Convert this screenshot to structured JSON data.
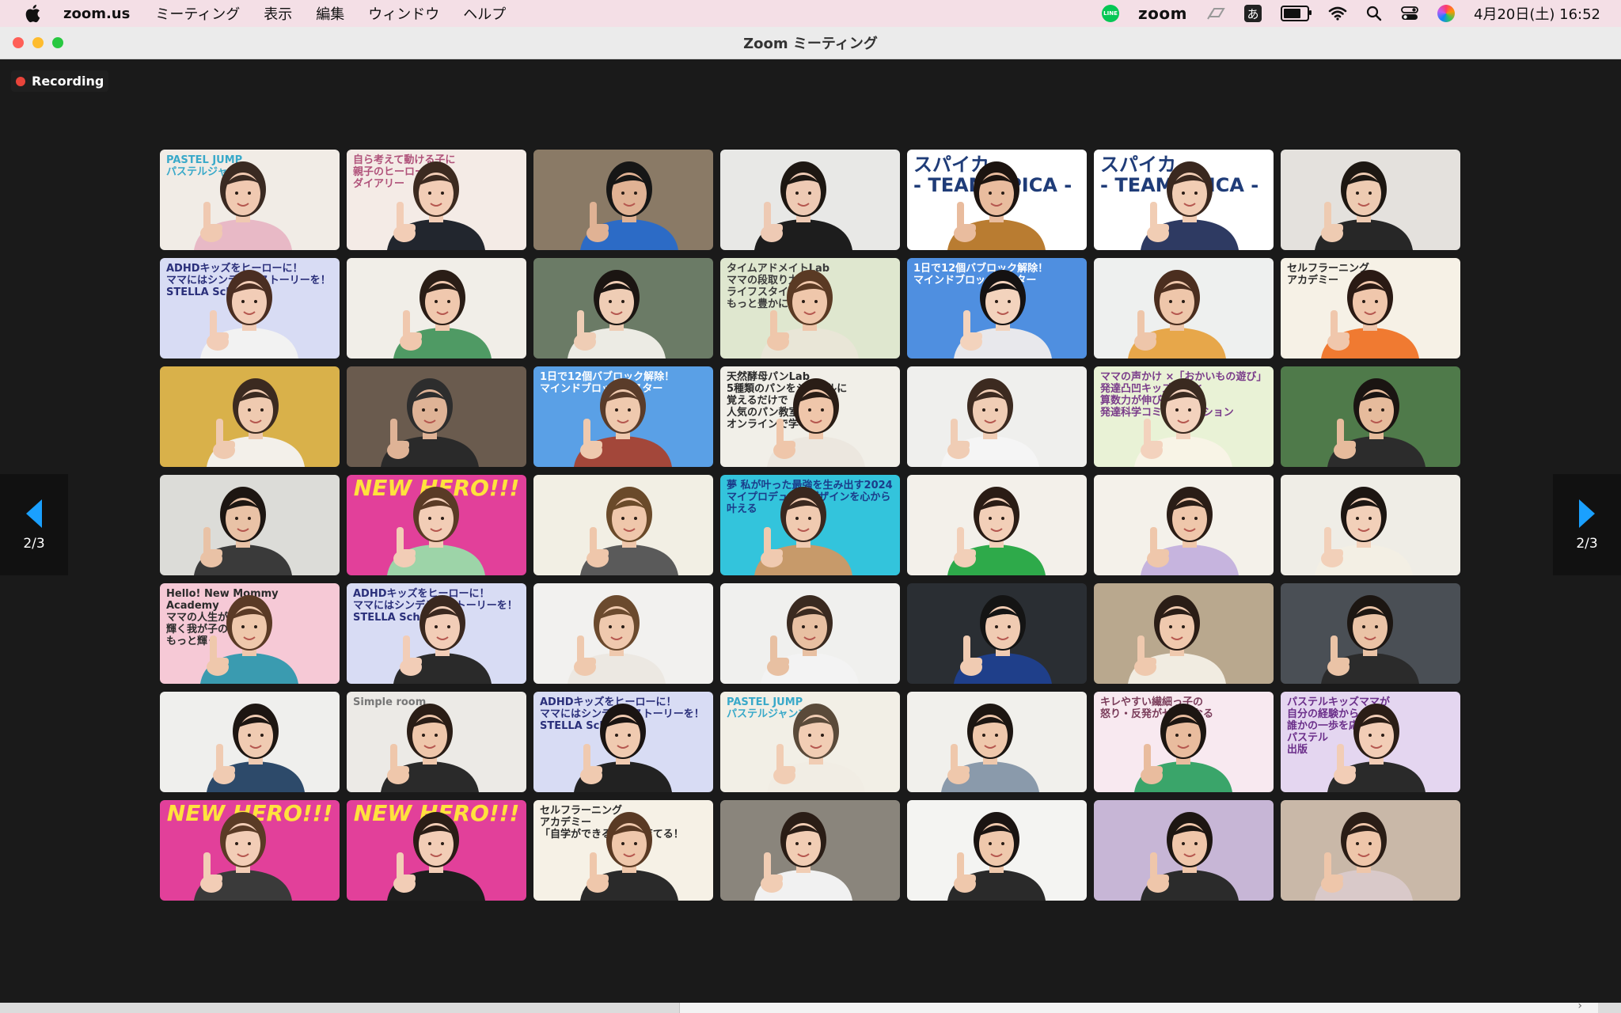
{
  "menubar": {
    "app_name": "zoom.us",
    "menus": [
      "ミーティング",
      "表示",
      "編集",
      "ウィンドウ",
      "ヘルプ"
    ],
    "line_badge": "LINE",
    "zoom_label": "zoom",
    "ime": "あ",
    "battery_level": 0.8,
    "datetime": "4月20日(土)  16:52",
    "icons": [
      "apple-icon",
      "line-icon",
      "zoom-status-icon",
      "stage-manager-icon",
      "ime-icon",
      "battery-icon",
      "wifi-icon",
      "search-icon",
      "control-center-icon",
      "siri-icon"
    ]
  },
  "window": {
    "title": "Zoom ミーティング",
    "traffic_lights": {
      "close": "#ff5f57",
      "minimize": "#febc2e",
      "maximize": "#28c840"
    }
  },
  "recording": {
    "label": "Recording"
  },
  "pagination": {
    "prev_label": "2/3",
    "next_label": "2/3",
    "arrow_color": "#1aa0ff"
  },
  "participants": [
    {
      "bg": "#f1ece6",
      "skin": "#f0c9b1",
      "hair": "#3a2a22",
      "shirt": "#e8b9c6",
      "text": "PASTEL JUMP\nパステルジャンプ",
      "text_color": "#39a9c9",
      "text_style": ""
    },
    {
      "bg": "#f4ebe6",
      "skin": "#f2cdb6",
      "hair": "#3c2a20",
      "shirt": "#22262e",
      "text": "自ら考えて動ける子に\n親子のヒーローズ\nダイアリー",
      "text_color": "#b0527a",
      "text_style": ""
    },
    {
      "bg": "#8a7a66",
      "skin": "#e0b294",
      "hair": "#161616",
      "shirt": "#2c6bc6",
      "text": "",
      "text_color": "#000",
      "text_style": ""
    },
    {
      "bg": "#e8e8e6",
      "skin": "#eecab4",
      "hair": "#1d1712",
      "shirt": "#1d1d1d",
      "text": "",
      "text_color": "#000",
      "text_style": ""
    },
    {
      "bg": "#ffffff",
      "skin": "#e9bc9e",
      "hair": "#1c1410",
      "shirt": "#b97c31",
      "text": "スパイカ\n- TEAM SPICA -",
      "text_color": "#1f3c78",
      "text_style": "big"
    },
    {
      "bg": "#ffffff",
      "skin": "#f1cdb4",
      "hair": "#3a281f",
      "shirt": "#2e3a62",
      "text": "スパイカ\n- TEAM SPICA -",
      "text_color": "#1f3c78",
      "text_style": "big"
    },
    {
      "bg": "#e4e1dd",
      "skin": "#eecbb2",
      "hair": "#1d1712",
      "shirt": "#272727",
      "text": "",
      "text_color": "#000",
      "text_style": ""
    },
    {
      "bg": "#d8dcf4",
      "skin": "#f2cdb7",
      "hair": "#4a2e22",
      "shirt": "#f2f2f2",
      "text": "ADHDキッズをヒーローに！\nママにはシンデレラストーリーを！\nSTELLA School",
      "text_color": "#2a2f7a",
      "text_style": ""
    },
    {
      "bg": "#f1eee8",
      "skin": "#f0c8ae",
      "hair": "#2a1d16",
      "shirt": "#4f9a64",
      "text": "",
      "text_color": "#000",
      "text_style": ""
    },
    {
      "bg": "#6b7b66",
      "skin": "#efcdb5",
      "hair": "#1b1512",
      "shirt": "#ecebe4",
      "text": "",
      "text_color": "#000",
      "text_style": ""
    },
    {
      "bg": "#dfe7cf",
      "skin": "#efc7ab",
      "hair": "#5a3a24",
      "shirt": "#e9e6d7",
      "text": "タイムアドメイトLab\nママの段取り力で\nライフスタイルを\nもっと豊かに！",
      "text_color": "#3b3b3b",
      "text_style": ""
    },
    {
      "bg": "#4f8fe0",
      "skin": "#f3d3bd",
      "hair": "#151212",
      "shirt": "#e8e8ec",
      "text": "1日で12個バブロック解除！\nマインドブロックバスター",
      "text_color": "#ffffff",
      "text_style": ""
    },
    {
      "bg": "#eef0ef",
      "skin": "#eec6aa",
      "hair": "#4b2e1f",
      "shirt": "#e7a74a",
      "text": "",
      "text_color": "#000",
      "text_style": ""
    },
    {
      "bg": "#f6f1e6",
      "skin": "#f0c7ac",
      "hair": "#2a1a14",
      "shirt": "#f07a31",
      "text": "セルフラーニング\nアカデミー",
      "text_color": "#2a2a2a",
      "text_style": ""
    },
    {
      "bg": "#d9b14a",
      "skin": "#efcab0",
      "hair": "#3b2a20",
      "shirt": "#f3f0ea",
      "text": "",
      "text_color": "#000",
      "text_style": ""
    },
    {
      "bg": "#6a5b4e",
      "skin": "#dfb396",
      "hair": "#2d2d2d",
      "shirt": "#2a2a2a",
      "text": "",
      "text_color": "#000",
      "text_style": ""
    },
    {
      "bg": "#5aa0e6",
      "skin": "#efc9ae",
      "hair": "#5a3c2a",
      "shirt": "#a3473a",
      "text": "1日で12個バブロック解除！\nマインドブロックバスター",
      "text_color": "#ffffff",
      "text_style": ""
    },
    {
      "bg": "#f1efe8",
      "skin": "#efc6aa",
      "hair": "#2a1d16",
      "shirt": "#ece7df",
      "text": "天然酵母パンLab\n5種類のパンをシンプルに\n覚えるだけで\n人気のパン教室が\nオンラインで学べる",
      "text_color": "#2b2b2b",
      "text_style": ""
    },
    {
      "bg": "#efefed",
      "skin": "#f0cdb5",
      "hair": "#3c2a20",
      "shirt": "#f5f5f5",
      "text": "",
      "text_color": "#000",
      "text_style": ""
    },
    {
      "bg": "#e9f2d6",
      "skin": "#f3d2bd",
      "hair": "#3a2a20",
      "shirt": "#f8f4e6",
      "text": "ママの声かけ ×「おかいもの遊び」\n発達凸凹キッズの脳と\n算数力が伸びる！\n発達科学コミュニケーション",
      "text_color": "#7a3c8a",
      "text_style": ""
    },
    {
      "bg": "#4f7a4a",
      "skin": "#e6bb9c",
      "hair": "#1a1412",
      "shirt": "#2c2c2c",
      "text": "",
      "text_color": "#000",
      "text_style": ""
    },
    {
      "bg": "#dcdcd8",
      "skin": "#e9c2a6",
      "hair": "#1d1612",
      "shirt": "#3a3a3a",
      "text": "",
      "text_color": "#000",
      "text_style": ""
    },
    {
      "bg": "#e2409a",
      "skin": "#f2cdb6",
      "hair": "#5a3b26",
      "shirt": "#9dd4a8",
      "text": "NEW HERO!!!",
      "text_color": "#ffe23d",
      "text_style": "hero"
    },
    {
      "bg": "#f2efe4",
      "skin": "#efc7ab",
      "hair": "#6a4a2a",
      "shirt": "#5a5a5a",
      "text": "",
      "text_color": "#000",
      "text_style": ""
    },
    {
      "bg": "#33c4dc",
      "skin": "#f0cab0",
      "hair": "#3a281f",
      "shirt": "#c79a6a",
      "text": "夢 私が叶った最強を生み出す2024\nマイプロデュースデザインを心から叶える",
      "text_color": "#1b3c8a",
      "text_style": ""
    },
    {
      "bg": "#f3f0ea",
      "skin": "#f2cfb8",
      "hair": "#2a1c15",
      "shirt": "#2eaa4a",
      "text": "",
      "text_color": "#000",
      "text_style": ""
    },
    {
      "bg": "#f4f1ea",
      "skin": "#efc7ab",
      "hair": "#2a1d16",
      "shirt": "#c6b4de",
      "text": "",
      "text_color": "#000",
      "text_style": ""
    },
    {
      "bg": "#efede6",
      "skin": "#f2d0b9",
      "hair": "#1d1612",
      "shirt": "#f3efe4",
      "text": "",
      "text_color": "#000",
      "text_style": ""
    },
    {
      "bg": "#f6c9d6",
      "skin": "#efc8ac",
      "hair": "#5a3a26",
      "shirt": "#3a9bb0",
      "text": "Hello! New Mommy Academy\nママの人生が\n輝く我が子の未来が\nもっと輝く",
      "text_color": "#2b2b2b",
      "text_style": ""
    },
    {
      "bg": "#d8dcf4",
      "skin": "#f2cdb7",
      "hair": "#3a281f",
      "shirt": "#2a2a2a",
      "text": "ADHDキッズをヒーローに！\nママにはシンデレラストーリーを！\nSTELLA School",
      "text_color": "#2a2f7a",
      "text_style": ""
    },
    {
      "bg": "#f2f1ef",
      "skin": "#efc9ae",
      "hair": "#6b4a2e",
      "shirt": "#ece8e2",
      "text": "",
      "text_color": "#000",
      "text_style": ""
    },
    {
      "bg": "#f0f0ee",
      "skin": "#e8c0a2",
      "hair": "#3a2a20",
      "shirt": "#f3f3f3",
      "text": "",
      "text_color": "#000",
      "text_style": ""
    },
    {
      "bg": "#2a2e33",
      "skin": "#f0cbb2",
      "hair": "#141414",
      "shirt": "#1f3f8a",
      "text": "",
      "text_color": "#000",
      "text_style": ""
    },
    {
      "bg": "#b9a88e",
      "skin": "#efc9ae",
      "hair": "#2a1d16",
      "shirt": "#f1ece1",
      "text": "",
      "text_color": "#000",
      "text_style": ""
    },
    {
      "bg": "#4a4f55",
      "skin": "#eac3a6",
      "hair": "#1c1612",
      "shirt": "#2b2b2b",
      "text": "",
      "text_color": "#000",
      "text_style": ""
    },
    {
      "bg": "#efefed",
      "skin": "#f0cbb2",
      "hair": "#1d1612",
      "shirt": "#2d4a6a",
      "text": "",
      "text_color": "#000",
      "text_style": ""
    },
    {
      "bg": "#eceae6",
      "skin": "#efc7ab",
      "hair": "#2a1d16",
      "shirt": "#2a2a2a",
      "text": "Simple room",
      "text_color": "#777777",
      "text_style": ""
    },
    {
      "bg": "#d8dcf4",
      "skin": "#f0cab0",
      "hair": "#1a1412",
      "shirt": "#222222",
      "text": "ADHDキッズをヒーローに！\nママにはシンデレラストーリーを！\nSTELLA School",
      "text_color": "#2a2f7a",
      "text_style": ""
    },
    {
      "bg": "#f2efe6",
      "skin": "#f1cdb4",
      "hair": "#5a4a3a",
      "shirt": "#f1ede4",
      "text": "PASTEL JUMP\nパステルジャンプ",
      "text_color": "#39a9c9",
      "text_style": ""
    },
    {
      "bg": "#f1f0ec",
      "skin": "#efc8ac",
      "hair": "#1d1612",
      "shirt": "#8a9aab",
      "text": "",
      "text_color": "#000",
      "text_style": ""
    },
    {
      "bg": "#f8e9f0",
      "skin": "#e9bc9e",
      "hair": "#1d1612",
      "shirt": "#3aa56a",
      "text": "キレやすい繊細っ子の\n怒り・反発がゼロになる",
      "text_color": "#7a3c5a",
      "text_style": ""
    },
    {
      "bg": "#e4d6f0",
      "skin": "#f2cdb6",
      "hair": "#2a1d16",
      "shirt": "#2a2a2a",
      "text": "パステルキッズママが\n自分の経験から\n誰かの一歩を応援する\nパステル\n出版",
      "text_color": "#6b2f8a",
      "text_style": ""
    },
    {
      "bg": "#e2409a",
      "skin": "#f2cdb6",
      "hair": "#5a3b26",
      "shirt": "#3a3a3a",
      "text": "NEW HERO!!!",
      "text_color": "#ffe23d",
      "text_style": "hero"
    },
    {
      "bg": "#e2409a",
      "skin": "#f2cdb6",
      "hair": "#2a1d16",
      "shirt": "#1e1e1e",
      "text": "NEW HERO!!!",
      "text_color": "#ffe23d",
      "text_style": "hero"
    },
    {
      "bg": "#f6f1e6",
      "skin": "#efc7ab",
      "hair": "#5a3a24",
      "shirt": "#2a2a2a",
      "text": "セルフラーニング\nアカデミー\n「自学ができる子」を育てる！",
      "text_color": "#2a2a2a",
      "text_style": ""
    },
    {
      "bg": "#8a857c",
      "skin": "#f1cdb4",
      "hair": "#2a1d16",
      "shirt": "#f1f1f1",
      "text": "",
      "text_color": "#000",
      "text_style": ""
    },
    {
      "bg": "#f4f4f2",
      "skin": "#efc8ac",
      "hair": "#1a1412",
      "shirt": "#2a2a2a",
      "text": "",
      "text_color": "#000",
      "text_style": ""
    },
    {
      "bg": "#c7b6d6",
      "skin": "#efc6aa",
      "hair": "#1d1612",
      "shirt": "#2b2b2b",
      "text": "",
      "text_color": "#000",
      "text_style": ""
    },
    {
      "bg": "#c9b8a8",
      "skin": "#eec6aa",
      "hair": "#2a1d16",
      "shirt": "#d9c9c9",
      "text": "",
      "text_color": "#000",
      "text_style": ""
    }
  ]
}
